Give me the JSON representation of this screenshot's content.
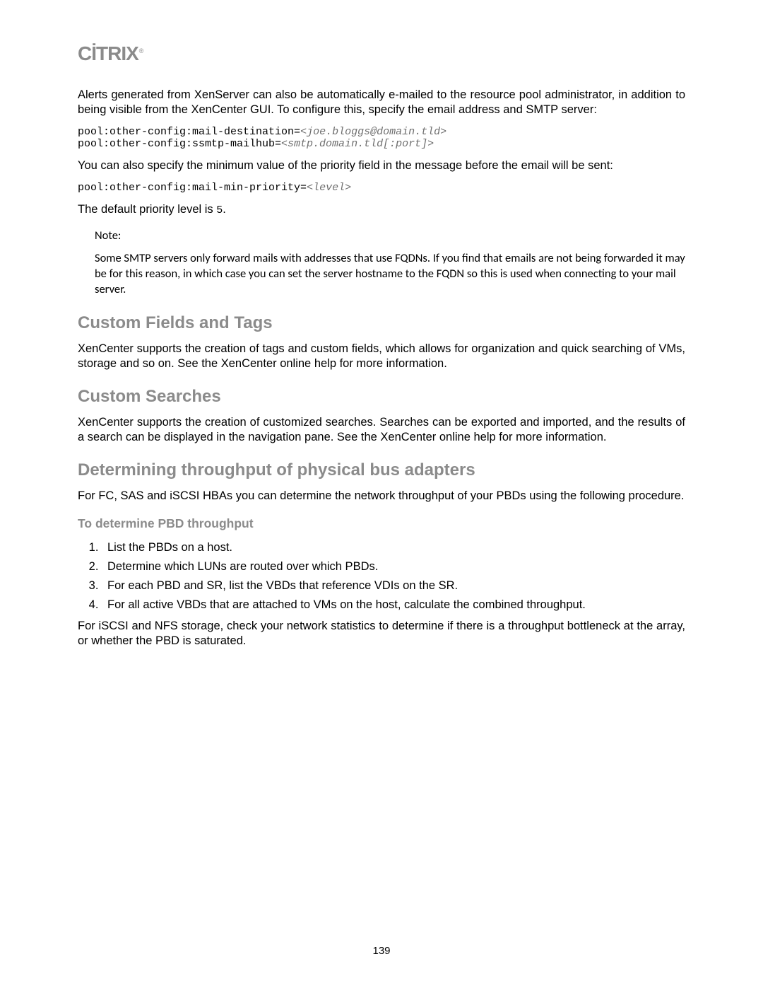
{
  "logo": "CİTRIX",
  "logo_ring": "®",
  "intro": "Alerts generated from XenServer can also be automatically e-mailed to the resource pool administrator, in addition to being visible from the XenCenter GUI. To configure this, specify the email address and SMTP server:",
  "code1": {
    "line1_prefix": "pool:other-config:mail-destination=",
    "line1_repl": "<joe.bloggs@domain.tld>",
    "line2_prefix": "pool:other-config:ssmtp-mailhub=",
    "line2_repl": "<smtp.domain.tld[:port]>"
  },
  "para2": "You can also specify the minimum value of the priority field in the message before the email will be sent:",
  "code2": {
    "prefix": "pool:other-config:mail-min-priority=",
    "repl": "<level>"
  },
  "para3_pre": "The default priority level is ",
  "para3_literal": "5",
  "para3_post": ".",
  "note_label": "Note:",
  "note_body": "Some SMTP servers only forward mails with addresses that use FQDNs. If you find that emails are not being forwarded it may be for this reason, in which case you can set the server hostname to the FQDN so this is used when connecting to your mail server.",
  "h_custom_fields": "Custom Fields and Tags",
  "p_custom_fields": "XenCenter supports the creation of tags and custom fields, which allows for organization and quick searching of VMs, storage and so on. See the XenCenter online help for more information.",
  "h_custom_searches": "Custom Searches",
  "p_custom_searches": "XenCenter supports the creation of customized searches. Searches can be exported and imported, and the results of a search can be displayed in the navigation pane. See the XenCenter online help for more information.",
  "h_throughput": "Determining throughput of physical bus adapters",
  "p_throughput": "For FC, SAS and iSCSI HBAs you can determine the network throughput of your PBDs using the following procedure.",
  "h_procedure": "To determine PBD throughput",
  "steps": [
    "List the PBDs on a host.",
    "Determine which LUNs are routed over which PBDs.",
    "For each PBD and SR, list the VBDs that reference VDIs on the SR.",
    "For all active VBDs that are attached to VMs on the host, calculate the combined throughput."
  ],
  "p_closing": "For iSCSI and NFS storage, check your network statistics to determine if there is a throughput bottleneck at the array, or whether the PBD is saturated.",
  "page_number": "139"
}
